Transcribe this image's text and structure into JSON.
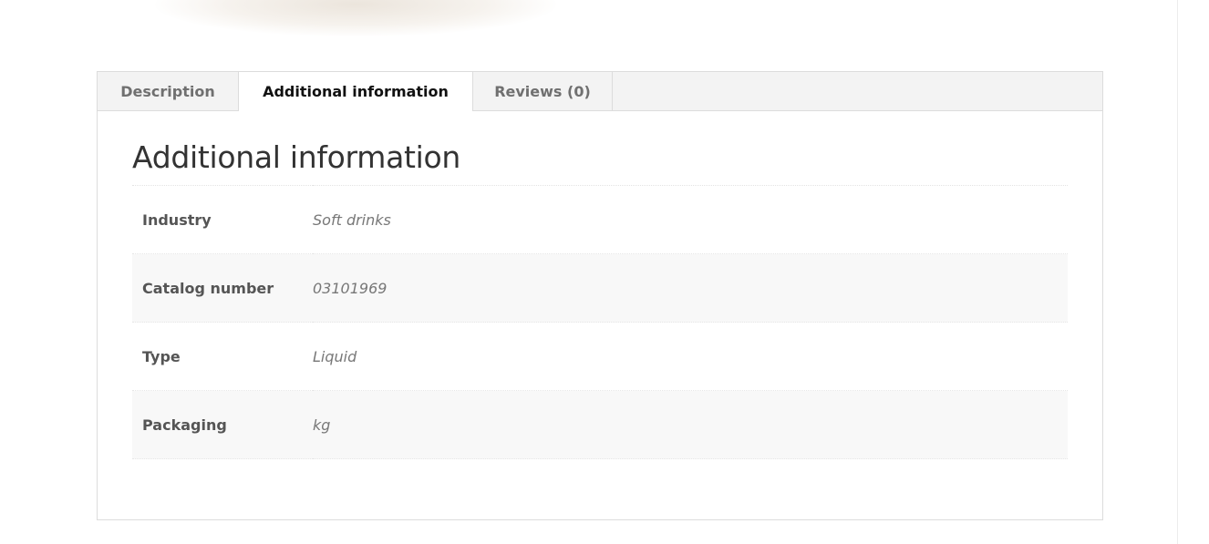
{
  "tabs": [
    {
      "label": "Description",
      "active": false
    },
    {
      "label": "Additional information",
      "active": true
    },
    {
      "label": "Reviews (0)",
      "active": false
    }
  ],
  "panel": {
    "title": "Additional information",
    "attributes": [
      {
        "label": "Industry",
        "value": "Soft drinks"
      },
      {
        "label": "Catalog number",
        "value": "03101969"
      },
      {
        "label": "Type",
        "value": "Liquid"
      },
      {
        "label": "Packaging",
        "value": "kg"
      }
    ]
  },
  "colors": {
    "tab_bar_bg": "#f3f3f3",
    "active_tab_text": "#111111",
    "inactive_tab_text": "#707070",
    "alt_row_bg": "#f8f8f8",
    "border": "#dcdcdc"
  }
}
